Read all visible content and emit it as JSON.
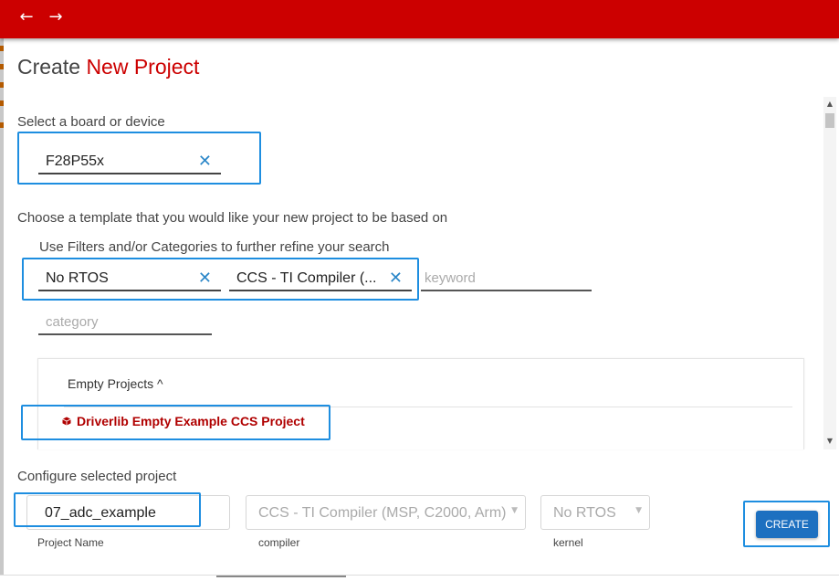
{
  "nav": {
    "back_glyph": "←",
    "forward_glyph": "→"
  },
  "page": {
    "title_prefix": "Create",
    "title_accent": "New Project"
  },
  "board": {
    "label": "Select a board or device",
    "value": "F28P55x",
    "clear_glyph": "✕"
  },
  "template": {
    "label": "Choose a template that you would like your new project to be based on",
    "filter_hint": "Use Filters and/or Categories to further refine your search",
    "filters": [
      {
        "value": "No RTOS"
      },
      {
        "value": "CCS - TI Compiler (..."
      }
    ],
    "keyword_placeholder": "keyword",
    "category_placeholder": "category",
    "clear_glyph": "✕"
  },
  "results": {
    "category_header": "Empty Projects ^",
    "items": [
      {
        "label": "Driverlib Empty Example CCS Project",
        "icon": "project-cube-icon"
      }
    ]
  },
  "configure": {
    "label": "Configure selected project",
    "project_name": {
      "value": "07_adc_example",
      "label": "Project Name"
    },
    "compiler": {
      "value": "CCS - TI Compiler (MSP, C2000, Arm)",
      "label": "compiler",
      "caret": "▼"
    },
    "kernel": {
      "value": "No RTOS",
      "label": "kernel",
      "caret": "▼"
    },
    "create_label": "CREATE"
  },
  "scrollbar": {
    "up_glyph": "▲",
    "down_glyph": "▼"
  },
  "colors": {
    "brand": "#cc0000",
    "highlight": "#1e8ee0",
    "primary_button": "#1d70c0",
    "clear_icon": "#2a86c8"
  }
}
